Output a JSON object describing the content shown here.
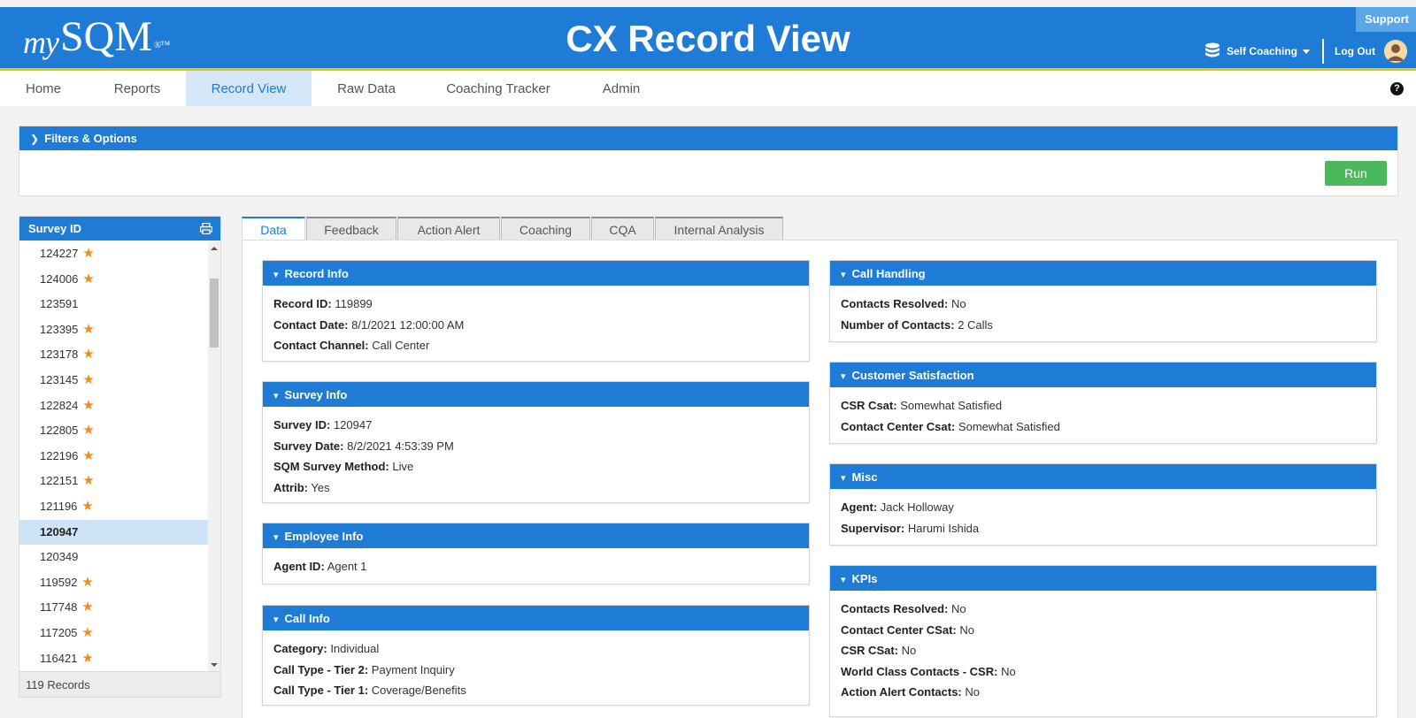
{
  "header": {
    "logo_prefix": "my",
    "logo_brand": "SQM",
    "logo_reg": "®™",
    "title": "CX Record View",
    "support": "Support",
    "mode": "Self Coaching",
    "logout": "Log Out",
    "brand_color": "#1e7cd6",
    "accent_color": "#f2c200"
  },
  "nav": {
    "items": [
      "Home",
      "Reports",
      "Record View",
      "Raw Data",
      "Coaching Tracker",
      "Admin"
    ],
    "active": "Record View",
    "help": "?"
  },
  "filters": {
    "title": "Filters & Options",
    "run": "Run"
  },
  "survey_list": {
    "header": "Survey ID",
    "items": [
      {
        "id": "124227",
        "starred": true
      },
      {
        "id": "124006",
        "starred": true
      },
      {
        "id": "123591",
        "starred": false
      },
      {
        "id": "123395",
        "starred": true
      },
      {
        "id": "123178",
        "starred": true
      },
      {
        "id": "123145",
        "starred": true
      },
      {
        "id": "122824",
        "starred": true
      },
      {
        "id": "122805",
        "starred": true
      },
      {
        "id": "122196",
        "starred": true
      },
      {
        "id": "122151",
        "starred": true
      },
      {
        "id": "121196",
        "starred": true
      },
      {
        "id": "120947",
        "starred": false,
        "selected": true
      },
      {
        "id": "120349",
        "starred": false
      },
      {
        "id": "119592",
        "starred": true
      },
      {
        "id": "117748",
        "starred": true
      },
      {
        "id": "117205",
        "starred": true
      },
      {
        "id": "116421",
        "starred": true
      }
    ],
    "footer": "119 Records"
  },
  "tabs": [
    "Data",
    "Feedback",
    "Action Alert",
    "Coaching",
    "CQA",
    "Internal Analysis"
  ],
  "active_tab": "Data",
  "cards": {
    "record_info": {
      "title": "Record Info",
      "fields": [
        {
          "label": "Record ID:",
          "value": "119899"
        },
        {
          "label": "Contact Date:",
          "value": "8/1/2021 12:00:00 AM"
        },
        {
          "label": "Contact Channel:",
          "value": "Call Center"
        }
      ]
    },
    "survey_info": {
      "title": "Survey Info",
      "fields": [
        {
          "label": "Survey ID:",
          "value": "120947"
        },
        {
          "label": "Survey Date:",
          "value": "8/2/2021 4:53:39 PM"
        },
        {
          "label": "SQM Survey Method:",
          "value": "Live"
        },
        {
          "label": "Attrib:",
          "value": "Yes"
        }
      ]
    },
    "employee_info": {
      "title": "Employee Info",
      "fields": [
        {
          "label": "Agent ID:",
          "value": "Agent 1"
        }
      ]
    },
    "call_info": {
      "title": "Call Info",
      "fields": [
        {
          "label": "Category:",
          "value": "Individual"
        },
        {
          "label": "Call Type - Tier 2:",
          "value": "Payment Inquiry"
        },
        {
          "label": "Call Type - Tier 1:",
          "value": "Coverage/Benefits"
        }
      ]
    },
    "call_handling": {
      "title": "Call Handling",
      "fields": [
        {
          "label": "Contacts Resolved:",
          "value": "No"
        },
        {
          "label": "Number of Contacts:",
          "value": "2 Calls"
        }
      ]
    },
    "customer_satisfaction": {
      "title": "Customer Satisfaction",
      "fields": [
        {
          "label": "CSR Csat:",
          "value": "Somewhat Satisfied"
        },
        {
          "label": "Contact Center Csat:",
          "value": "Somewhat Satisfied"
        }
      ]
    },
    "misc": {
      "title": "Misc",
      "fields": [
        {
          "label": "Agent:",
          "value": "Jack Holloway"
        },
        {
          "label": "Supervisor:",
          "value": "Harumi Ishida"
        }
      ]
    },
    "kpis": {
      "title": "KPIs",
      "fields": [
        {
          "label": "Contacts Resolved:",
          "value": "No"
        },
        {
          "label": "Contact Center CSat:",
          "value": "No"
        },
        {
          "label": "CSR CSat:",
          "value": "No"
        },
        {
          "label": "World Class Contacts - CSR:",
          "value": "No"
        },
        {
          "label": "Action Alert Contacts:",
          "value": "No"
        }
      ]
    }
  }
}
